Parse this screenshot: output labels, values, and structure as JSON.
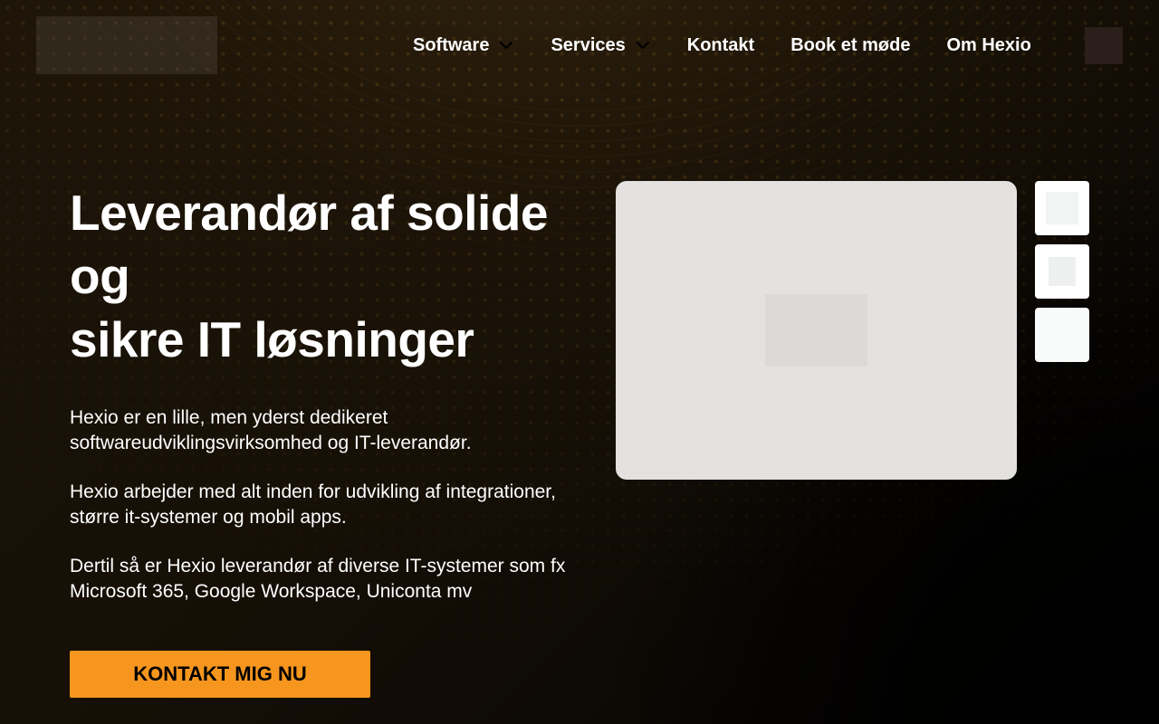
{
  "nav": {
    "items": [
      {
        "label": "Software",
        "has_dropdown": true,
        "icon": "chevron-down-icon"
      },
      {
        "label": "Services",
        "has_dropdown": true,
        "icon": "chevron-down-icon"
      },
      {
        "label": "Kontakt",
        "has_dropdown": false
      },
      {
        "label": "Book et møde",
        "has_dropdown": false
      },
      {
        "label": "Om Hexio",
        "has_dropdown": false
      }
    ],
    "menu_icon": "menu-icon"
  },
  "hero": {
    "title_lines": [
      "Leverandør af solide",
      "og",
      "sikre IT løsninger"
    ],
    "paragraphs": [
      "Hexio er en lille, men yderst dedikeret softwareudviklingsvirksomhed og IT-leverandør.",
      "Hexio arbejder med alt inden for udvikling af integrationer, større it-systemer og mobil apps.",
      "Dertil så er Hexio leverandør af diverse IT-systemer som fx Microsoft 365, Google Workspace, Uniconta mv"
    ],
    "cta_label": "KONTAKT MIG NU"
  },
  "colors": {
    "accent": "#f7961e",
    "background": "#150f06",
    "text": "#ffffff",
    "preview_bg": "#e3e2e0"
  }
}
